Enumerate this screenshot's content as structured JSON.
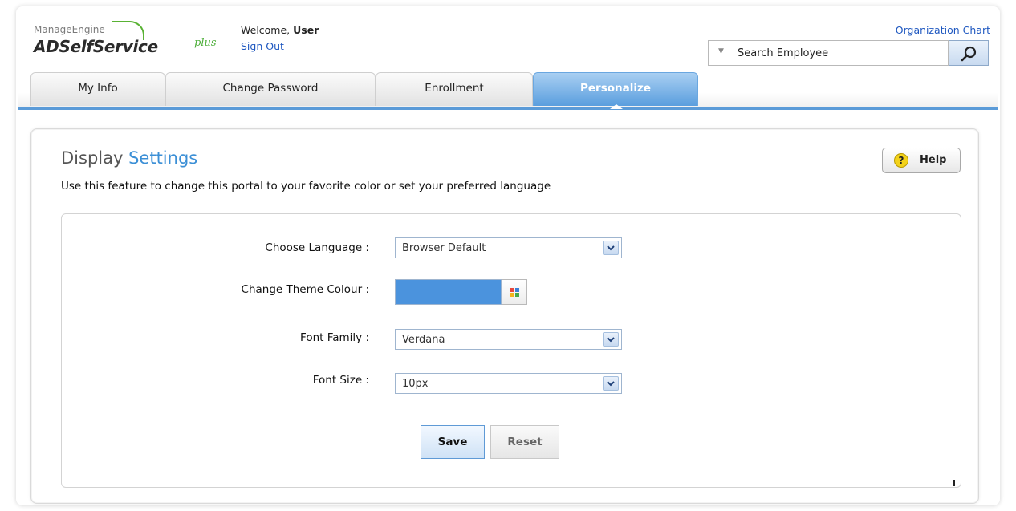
{
  "header": {
    "brand_top": "ManageEngine",
    "brand_main": "ADSelfService",
    "brand_plus": "plus",
    "welcome_prefix": "Welcome, ",
    "welcome_user": "User",
    "sign_out": "Sign Out",
    "org_chart": "Organization Chart",
    "search_placeholder": "Search Employee"
  },
  "tabs": [
    {
      "label": "My Info",
      "active": false
    },
    {
      "label": "Change Password",
      "active": false
    },
    {
      "label": "Enrollment",
      "active": false
    },
    {
      "label": "Personalize",
      "active": true
    }
  ],
  "page": {
    "title_part1": "Display ",
    "title_part2": "Settings",
    "description": "Use this feature to change this portal to your favorite color or set your preferred language",
    "help": "Help"
  },
  "form": {
    "language": {
      "label": "Choose Language :",
      "value": "Browser Default"
    },
    "theme": {
      "label": "Change Theme Colour :",
      "color": "#4b93dd"
    },
    "font_family": {
      "label": "Font Family :",
      "value": "Verdana"
    },
    "font_size": {
      "label": "Font Size :",
      "value": "10px"
    }
  },
  "buttons": {
    "save": "Save",
    "reset": "Reset"
  },
  "colors": {
    "accent": "#3b8fd6",
    "tab_active": "#5a9ede",
    "link": "#1f58c0",
    "brand_green": "#59b234"
  }
}
